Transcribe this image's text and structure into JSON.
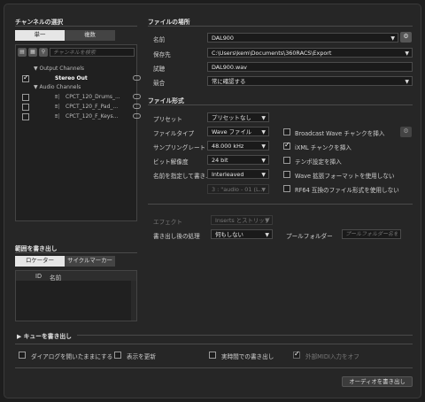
{
  "channels": {
    "header": "チャンネルの選択",
    "tabs": [
      "単一",
      "複数"
    ],
    "search_placeholder": "チャンネルを検索",
    "output_group": "Output Channels",
    "stereo_out": "Stereo Out",
    "audio_group": "Audio Channels",
    "audio_items": [
      "CPCT_120_Drums_...",
      "CPCT_120_F_Pad_...",
      "CPCT_120_F_Keys..."
    ]
  },
  "range": {
    "header": "範囲を書き出し",
    "tabs": [
      "ロケーター",
      "サイクルマーカー"
    ],
    "col_id": "ID",
    "col_name": "名前"
  },
  "file_location": {
    "header": "ファイルの場所",
    "name_label": "名前",
    "name_value": "DAL900",
    "path_label": "保存先",
    "path_value": "C:\\Users\\kem\\Documents\\360RACS\\Export",
    "preview_label": "試聴",
    "preview_value": "DAL900.wav",
    "conflict_label": "競合",
    "conflict_value": "常に確認する"
  },
  "file_format": {
    "header": "ファイル形式",
    "preset_label": "プリセット",
    "preset_value": "プリセットなし",
    "type_label": "ファイルタイプ",
    "type_value": "Wave ファイル",
    "rate_label": "サンプリングレート",
    "rate_value": "48.000 kHz",
    "bit_label": "ビット解像度",
    "bit_value": "24 bit",
    "name_spec_label": "名前を指定して書き...",
    "name_spec_value": "Interleaved",
    "name_spec_sub": "3 : \"audio - 01 (L...",
    "opt_bwf": "Broadcast Wave チャンクを挿入",
    "opt_ixml": "iXML チャンクを挿入",
    "opt_tempo": "テンポ設定を挿入",
    "opt_wave_ext": "Wave 拡張フォーマットを使用しない",
    "opt_rf64": "RF64 互換のファイル形式を使用しない"
  },
  "post": {
    "effect_label": "エフェクト",
    "effect_value": "Inserts とストリップ",
    "after_label": "書き出し後の処理",
    "after_value": "何もしない",
    "pool_label": "プールフォルダー",
    "pool_placeholder": "プールフォルダー名を入"
  },
  "queue": {
    "header": "キューを書き出し"
  },
  "bottom": {
    "keep_open": "ダイアログを開いたままにする",
    "update_display": "表示を更新",
    "realtime": "実時間での書き出し",
    "midi_off": "外部MIDI入力をオフ",
    "export_button": "オーディオを書き出し"
  }
}
